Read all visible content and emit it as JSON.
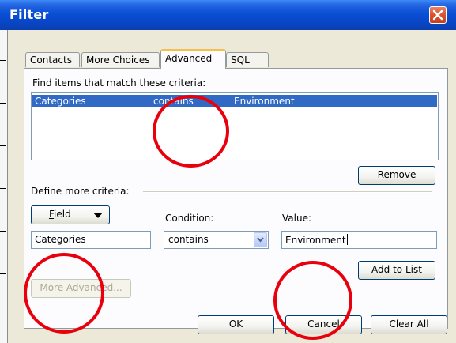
{
  "window": {
    "title": "Filter"
  },
  "tabs": [
    {
      "label": "Contacts",
      "active": false
    },
    {
      "label": "More Choices",
      "active": false
    },
    {
      "label": "Advanced",
      "active": true
    },
    {
      "label": "SQL",
      "active": false
    }
  ],
  "criteria": {
    "heading": "Find items that match these criteria:",
    "rows": [
      {
        "field": "Categories",
        "condition": "contains",
        "value": "Environment",
        "selected": true
      }
    ],
    "remove_label": "Remove"
  },
  "define": {
    "heading": "Define more criteria:",
    "field_button": "Field",
    "condition_label": "Condition:",
    "value_label": "Value:",
    "field_value": "Categories",
    "condition_value": "contains",
    "value_value": "Environment",
    "add_label": "Add to List"
  },
  "footer": {
    "more_advanced": "More Advanced...",
    "ok": "OK",
    "cancel": "Cancel",
    "clear_all": "Clear All"
  },
  "colors": {
    "titlebar": "#0a4fd6",
    "selection": "#316ac5",
    "annotation": "#e8000c",
    "close": "#d9542c"
  },
  "icons": {
    "close": "close-icon",
    "dropdown": "chevron-down-icon"
  }
}
